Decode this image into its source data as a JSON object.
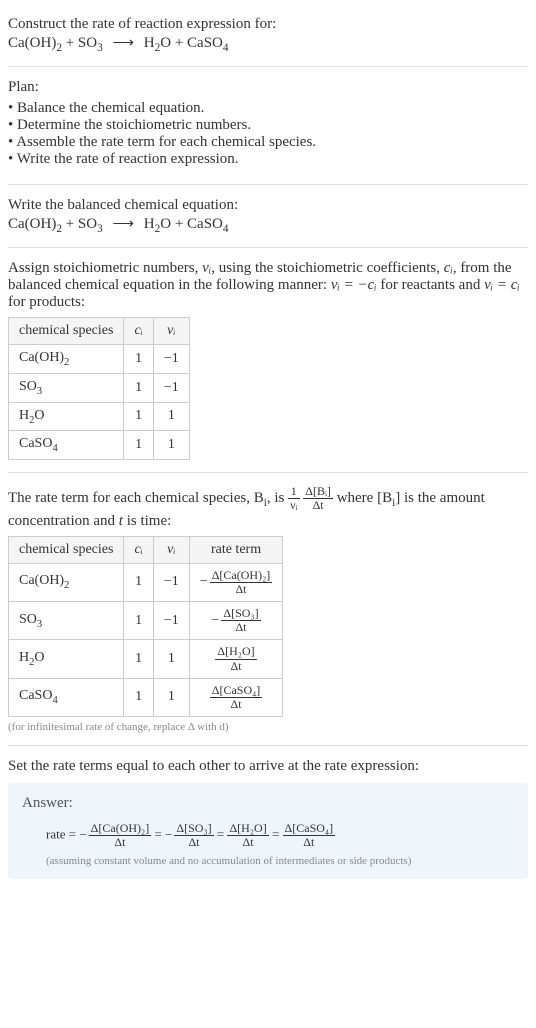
{
  "title": "Construct the rate of reaction expression for:",
  "equation_lhs1": "Ca(OH)",
  "equation_lhs1_sub": "2",
  "equation_plus": " + ",
  "equation_lhs2": "SO",
  "equation_lhs2_sub": "3",
  "arrow": "⟶",
  "equation_rhs1": "H",
  "equation_rhs1_sub": "2",
  "equation_rhs1b": "O",
  "equation_rhs2": "CaSO",
  "equation_rhs2_sub": "4",
  "plan_label": "Plan:",
  "plan_items": [
    "Balance the chemical equation.",
    "Determine the stoichiometric numbers.",
    "Assemble the rate term for each chemical species.",
    "Write the rate of reaction expression."
  ],
  "balanced_label": "Write the balanced chemical equation:",
  "assign_text_a": "Assign stoichiometric numbers, ",
  "assign_text_b": ", using the stoichiometric coefficients, ",
  "assign_text_c": ", from the balanced chemical equation in the following manner: ",
  "assign_text_d": " for reactants and ",
  "assign_text_e": " for products:",
  "nu_eq_neg_c": "νᵢ = −cᵢ",
  "nu_eq_c": "νᵢ = cᵢ",
  "nu_i": "νᵢ",
  "c_i": "cᵢ",
  "table1": {
    "head": [
      "chemical species",
      "cᵢ",
      "νᵢ"
    ],
    "rows": [
      {
        "species_html": "Ca(OH)<sub>2</sub>",
        "c": "1",
        "nu": "−1"
      },
      {
        "species_html": "SO<sub>3</sub>",
        "c": "1",
        "nu": "−1"
      },
      {
        "species_html": "H<sub>2</sub>O",
        "c": "1",
        "nu": "1"
      },
      {
        "species_html": "CaSO<sub>4</sub>",
        "c": "1",
        "nu": "1"
      }
    ]
  },
  "rate_term_text_a": "The rate term for each chemical species, B",
  "rate_term_text_b": ", is ",
  "rate_term_text_c": " where [B",
  "rate_term_text_d": "] is the amount concentration and ",
  "rate_term_text_e": " is time:",
  "t_var": "t",
  "frac1_num": "1",
  "frac1_den": "νᵢ",
  "frac2_num": "Δ[Bᵢ]",
  "frac2_den": "Δt",
  "table2": {
    "head": [
      "chemical species",
      "cᵢ",
      "νᵢ",
      "rate term"
    ],
    "rows": [
      {
        "species_html": "Ca(OH)<sub>2</sub>",
        "c": "1",
        "nu": "−1",
        "rt_num": "Δ[Ca(OH)₂]",
        "rt_den": "Δt",
        "neg": true
      },
      {
        "species_html": "SO<sub>3</sub>",
        "c": "1",
        "nu": "−1",
        "rt_num": "Δ[SO₃]",
        "rt_den": "Δt",
        "neg": true
      },
      {
        "species_html": "H<sub>2</sub>O",
        "c": "1",
        "nu": "1",
        "rt_num": "Δ[H₂O]",
        "rt_den": "Δt",
        "neg": false
      },
      {
        "species_html": "CaSO<sub>4</sub>",
        "c": "1",
        "nu": "1",
        "rt_num": "Δ[CaSO₄]",
        "rt_den": "Δt",
        "neg": false
      }
    ]
  },
  "note_infinitesimal": "(for infinitesimal rate of change, replace Δ with d)",
  "set_equal_text": "Set the rate terms equal to each other to arrive at the rate expression:",
  "answer_label": "Answer:",
  "rate_eq_prefix": "rate = ",
  "eq_sign": " = ",
  "minus": "−",
  "answer_terms": [
    {
      "num": "Δ[Ca(OH)₂]",
      "den": "Δt",
      "neg": true
    },
    {
      "num": "Δ[SO₃]",
      "den": "Δt",
      "neg": true
    },
    {
      "num": "Δ[H₂O]",
      "den": "Δt",
      "neg": false
    },
    {
      "num": "Δ[CaSO₄]",
      "den": "Δt",
      "neg": false
    }
  ],
  "assumption": "(assuming constant volume and no accumulation of intermediates or side products)",
  "chart_data": {
    "type": "table",
    "tables": [
      {
        "title": "Stoichiometric numbers",
        "columns": [
          "chemical species",
          "c_i",
          "nu_i"
        ],
        "rows": [
          [
            "Ca(OH)2",
            1,
            -1
          ],
          [
            "SO3",
            1,
            -1
          ],
          [
            "H2O",
            1,
            1
          ],
          [
            "CaSO4",
            1,
            1
          ]
        ]
      },
      {
        "title": "Rate terms",
        "columns": [
          "chemical species",
          "c_i",
          "nu_i",
          "rate term"
        ],
        "rows": [
          [
            "Ca(OH)2",
            1,
            -1,
            "-Δ[Ca(OH)2]/Δt"
          ],
          [
            "SO3",
            1,
            -1,
            "-Δ[SO3]/Δt"
          ],
          [
            "H2O",
            1,
            1,
            "Δ[H2O]/Δt"
          ],
          [
            "CaSO4",
            1,
            1,
            "Δ[CaSO4]/Δt"
          ]
        ]
      }
    ]
  }
}
